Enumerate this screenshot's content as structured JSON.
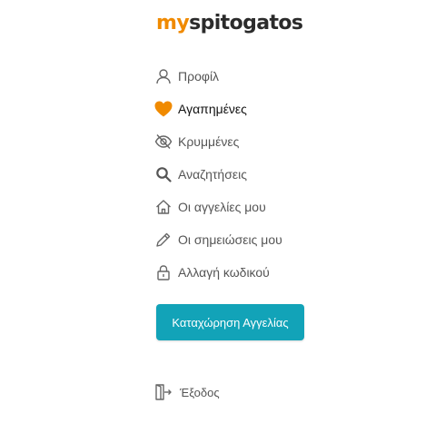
{
  "logo": {
    "prefix": "my",
    "name": "spitogatos"
  },
  "menu": {
    "items": [
      {
        "label": "Προφίλ",
        "icon": "person-icon"
      },
      {
        "label": "Αγαπημένες",
        "icon": "heart-icon",
        "active": true
      },
      {
        "label": "Κρυμμένες",
        "icon": "eye-off-icon"
      },
      {
        "label": "Αναζητήσεις",
        "icon": "search-icon"
      },
      {
        "label": "Οι αγγελίες μου",
        "icon": "house-icon"
      },
      {
        "label": "Οι σημειώσεις μου",
        "icon": "pencil-icon"
      },
      {
        "label": "Αλλαγή κωδικού",
        "icon": "lock-icon"
      }
    ]
  },
  "cta": {
    "label": "Καταχώρηση Αγγελίας"
  },
  "logout": {
    "label": "Έξοδος",
    "icon": "logout-icon"
  },
  "colors": {
    "brand_orange": "#f08a00",
    "brand_dark": "#2b2b2b",
    "cta_teal": "#12a3b8",
    "text_gray": "#555555"
  }
}
